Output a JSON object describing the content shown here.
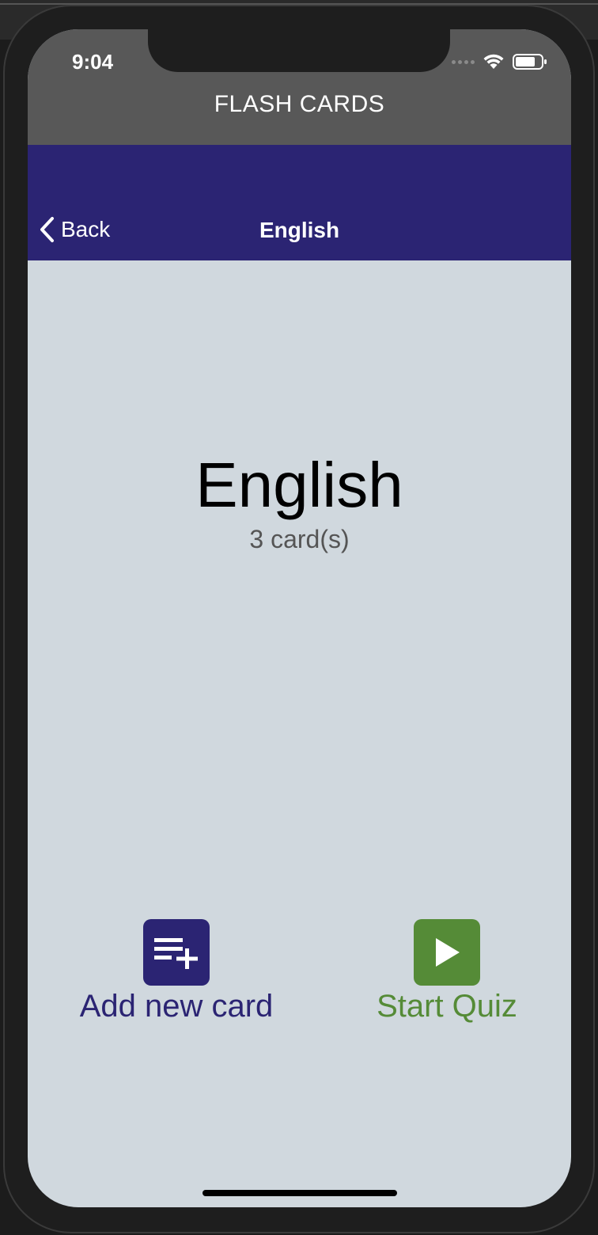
{
  "status_bar": {
    "time": "9:04",
    "icons": [
      "signal-dots-icon",
      "wifi-icon",
      "battery-icon"
    ]
  },
  "app": {
    "title": "FLASH CARDS"
  },
  "navbar": {
    "back_label": "Back",
    "title": "English",
    "color": "#2b2473"
  },
  "deck": {
    "title": "English",
    "count_text": "3 card(s)"
  },
  "actions": {
    "add": {
      "label": "Add new card",
      "icon": "playlist-add-icon",
      "color": "#2b2473"
    },
    "quiz": {
      "label": "Start Quiz",
      "icon": "play-icon",
      "color": "#558b37"
    }
  }
}
